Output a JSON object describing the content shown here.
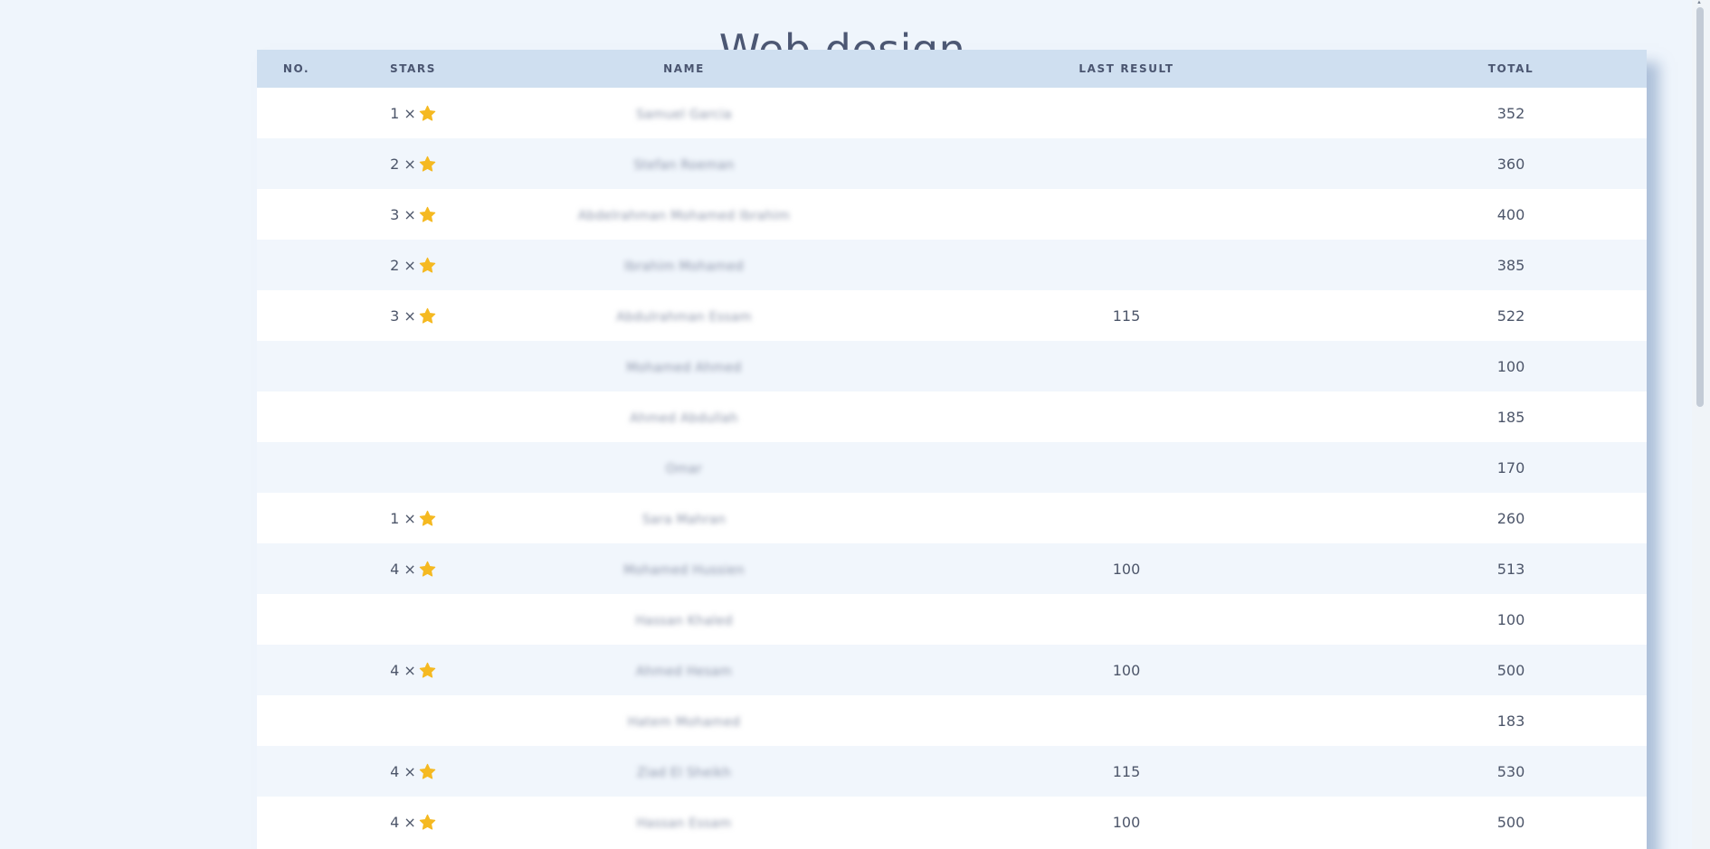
{
  "page": {
    "title": "Web design"
  },
  "table": {
    "headers": {
      "no": "NO.",
      "stars": "STARS",
      "name": "NAME",
      "last_result": "LAST RESULT",
      "total": "TOTAL"
    },
    "star_color": "#f5b921",
    "rows": [
      {
        "no": "",
        "stars": "1 ×",
        "has_star": true,
        "name": "Samuel Garcia",
        "last_result": "",
        "total": "352"
      },
      {
        "no": "",
        "stars": "2 ×",
        "has_star": true,
        "name": "Stefan Roeman",
        "last_result": "",
        "total": "360"
      },
      {
        "no": "",
        "stars": "3 ×",
        "has_star": true,
        "name": "Abdelrahman Mohamed Ibrahim",
        "last_result": "",
        "total": "400"
      },
      {
        "no": "",
        "stars": "2 ×",
        "has_star": true,
        "name": "Ibrahim Mohamed",
        "last_result": "",
        "total": "385"
      },
      {
        "no": "",
        "stars": "3 ×",
        "has_star": true,
        "name": "Abdulrahman Essam",
        "last_result": "115",
        "total": "522"
      },
      {
        "no": "",
        "stars": "",
        "has_star": false,
        "name": "Mohamed Ahmed",
        "last_result": "",
        "total": "100"
      },
      {
        "no": "",
        "stars": "",
        "has_star": false,
        "name": "Ahmed Abdullah",
        "last_result": "",
        "total": "185"
      },
      {
        "no": "",
        "stars": "",
        "has_star": false,
        "name": "Omar",
        "last_result": "",
        "total": "170"
      },
      {
        "no": "",
        "stars": "1 ×",
        "has_star": true,
        "name": "Sara Mahran",
        "last_result": "",
        "total": "260"
      },
      {
        "no": "",
        "stars": "4 ×",
        "has_star": true,
        "name": "Mohamed Hussien",
        "last_result": "100",
        "total": "513"
      },
      {
        "no": "",
        "stars": "",
        "has_star": false,
        "name": "Hassan Khaled",
        "last_result": "",
        "total": "100"
      },
      {
        "no": "",
        "stars": "4 ×",
        "has_star": true,
        "name": "Ahmed Hesam",
        "last_result": "100",
        "total": "500"
      },
      {
        "no": "",
        "stars": "",
        "has_star": false,
        "name": "Hatem Mohamed",
        "last_result": "",
        "total": "183"
      },
      {
        "no": "",
        "stars": "4 ×",
        "has_star": true,
        "name": "Ziad El Sheikh",
        "last_result": "115",
        "total": "530"
      },
      {
        "no": "",
        "stars": "4 ×",
        "has_star": true,
        "name": "Hassan Essam",
        "last_result": "100",
        "total": "500"
      }
    ]
  }
}
